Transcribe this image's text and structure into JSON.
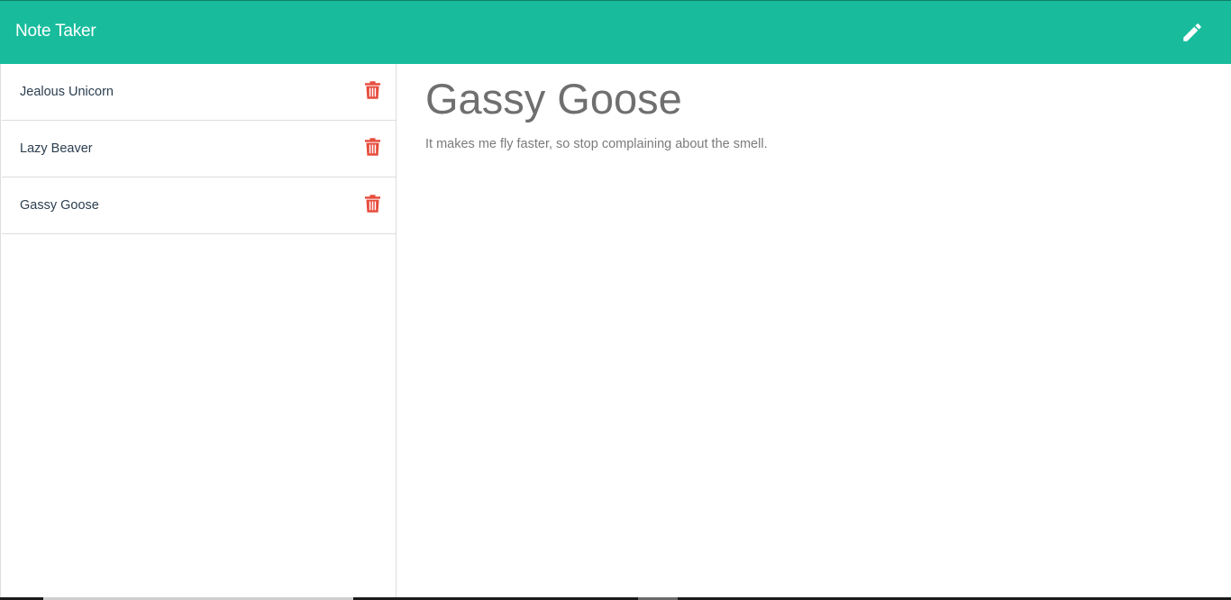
{
  "app": {
    "brand": "Note Taker",
    "new_note_icon": "pencil-icon"
  },
  "colors": {
    "navbar": "#18bc9c",
    "delete_icon": "#e74c3c",
    "title_text": "#6f6f6f"
  },
  "sidebar": {
    "notes": [
      {
        "title": "Jealous Unicorn",
        "icon": "trash-icon"
      },
      {
        "title": "Lazy Beaver",
        "icon": "trash-icon"
      },
      {
        "title": "Gassy Goose",
        "icon": "trash-icon"
      }
    ]
  },
  "main": {
    "title": "Gassy Goose",
    "text": "It makes me fly faster, so stop complaining about the smell."
  }
}
